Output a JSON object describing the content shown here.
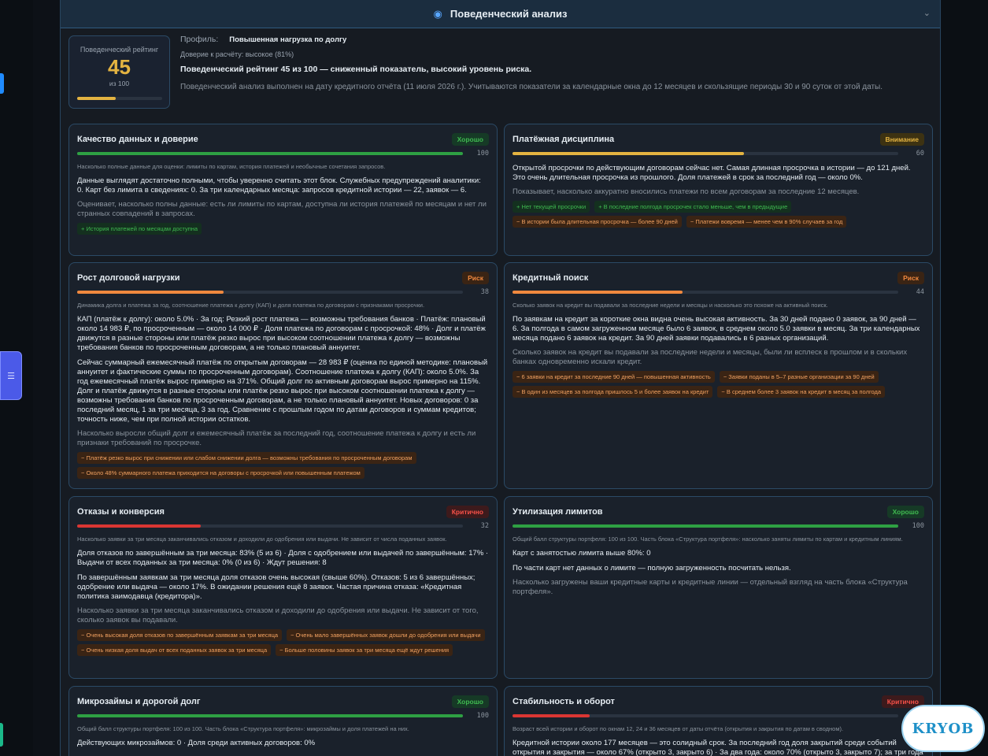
{
  "header": {
    "title": "Поведенческий анализ"
  },
  "summary": {
    "rating_label": "Поведенческий рейтинг",
    "score": "45",
    "of_label": "из 100",
    "score_fraction": 0.45,
    "profile_label": "Профиль:",
    "profile_value": "Повышенная нагрузка по долгу",
    "confidence": "Доверие к расчёту: высокое (81%)",
    "verdict": "Поведенческий рейтинг 45 из 100 — сниженный показатель, высокий уровень риска.",
    "description": "Поведенческий анализ выполнен на дату кредитного отчёта (11 июля 2026 г.). Учитываются показатели за календарные окна до 12 месяцев и скользящие периоды 30 и 90 суток от этой даты."
  },
  "cards": [
    {
      "title": "Качество данных и доверие",
      "badge": "Хорошо",
      "level": "good",
      "score": "100",
      "fraction": 1.0,
      "hint": "Насколько полные данные для оценки: лимиты по картам, история платежей и необычные сочетания запросов.",
      "body": [
        "Данные выглядят достаточно полными, чтобы уверенно считать этот блок. Служебных предупреждений аналитики: 0. Карт без лимита в сведениях: 0. За три календарных месяца: запросов кредитной истории — 22, заявок — 6."
      ],
      "muted": "Оценивает, насколько полны данные: есть ли лимиты по картам, доступна ли история платежей по месяцам и нет ли странных совпадений в запросах.",
      "tags": [
        {
          "text": "+ История платежей по месяцам доступна",
          "type": "pos"
        }
      ]
    },
    {
      "title": "Платёжная дисциплина",
      "badge": "Внимание",
      "level": "warn",
      "score": "60",
      "fraction": 0.6,
      "hint": "",
      "body": [
        "Открытой просрочки по действующим договорам сейчас нет. Самая длинная просрочка в истории — до 121 дней. Это очень длительная просрочка из прошлого. Доля платежей в срок за последний год — около 0%."
      ],
      "muted": "Показывает, насколько аккуратно вносились платежи по всем договорам за последние 12 месяцев.",
      "tags": [
        {
          "text": "+ Нет текущей просрочки",
          "type": "pos"
        },
        {
          "text": "+ В последние полгода просрочек стало меньше, чем в предыдущие",
          "type": "pos"
        },
        {
          "text": "− В истории была длительная просрочка — более 90 дней",
          "type": "neg"
        },
        {
          "text": "− Платежи вовремя — менее чем в 90% случаев за год",
          "type": "neg"
        }
      ]
    },
    {
      "title": "Рост долговой нагрузки",
      "badge": "Риск",
      "level": "risk",
      "score": "38",
      "fraction": 0.38,
      "hint": "Динамика долга и платежа за год, соотношение платежа к долгу (КАП) и доля платежа по договорам с признаками просрочки.",
      "body": [
        "КАП (платёж к долгу): около 5.0% · За год: Резкий рост платежа — возможны требования банков · Платёж: плановый около 14 983 ₽, по просроченным — около 14 000 ₽ · Доля платежа по договорам с просрочкой: 48% · Долг и платёж движутся в разные стороны или платёж резко вырос при высоком соотношении платежа к долгу — возможны требования банков по просроченным договорам, а не только плановый аннуитет.",
        "Сейчас суммарный ежемесячный платёж по открытым договорам — 28 983 ₽ (оценка по единой методике: плановый аннуитет и фактические суммы по просроченным договорам). Соотношение платежа к долгу (КАП): около 5.0%. За год ежемесячный платёж вырос примерно на 371%. Общий долг по активным договорам вырос примерно на 115%. Долг и платёж движутся в разные стороны или платёж резко вырос при высоком соотношении платежа к долгу — возможны требования банков по просроченным договорам, а не только плановый аннуитет. Новых договоров: 0 за последний месяц, 1 за три месяца, 3 за год. Сравнение с прошлым годом по датам договоров и суммам кредитов; точность ниже, чем при полной истории остатков."
      ],
      "muted": "Насколько выросли общий долг и ежемесячный платёж за последний год, соотношение платежа к долгу и есть ли признаки требований по просрочке.",
      "tags": [
        {
          "text": "− Платёж резко вырос при снижении или слабом снижении долга — возможны требования по просроченным договорам",
          "type": "neg"
        },
        {
          "text": "− Около 48% суммарного платежа приходится на договоры с просрочкой или повышенным платежом",
          "type": "neg"
        }
      ]
    },
    {
      "title": "Кредитный поиск",
      "badge": "Риск",
      "level": "risk",
      "score": "44",
      "fraction": 0.44,
      "hint": "Сколько заявок на кредит вы подавали за последние недели и месяцы и насколько это похоже на активный поиск.",
      "body": [
        "По заявкам на кредит за короткие окна видна очень высокая активность. За 30 дней подано 0 заявок, за 90 дней — 6. За полгода в самом загруженном месяце было 6 заявок, в среднем около 5.0 заявки в месяц. За три календарных месяца подано 6 заявок на кредит. За 90 дней заявки подавались в 6 разных организаций."
      ],
      "muted": "Сколько заявок на кредит вы подавали за последние недели и месяцы, были ли всплеск в прошлом и в скольких банках одновременно искали кредит.",
      "tags": [
        {
          "text": "− 6 заявки на кредит за последние 90 дней — повышенная активность",
          "type": "neg"
        },
        {
          "text": "− Заявки поданы в 5–7 разные организации за 90 дней",
          "type": "neg"
        },
        {
          "text": "− В один из месяцев за полгода пришлось 5 и более заявок на кредит",
          "type": "neg"
        },
        {
          "text": "− В среднем более 3 заявок на кредит в месяц за полгода",
          "type": "neg"
        }
      ]
    },
    {
      "title": "Отказы и конверсия",
      "badge": "Критично",
      "level": "crit",
      "score": "32",
      "fraction": 0.32,
      "hint": "Насколько заявки за три месяца заканчивались отказом и доходили до одобрения или выдачи. Не зависит от числа поданных заявок.",
      "body": [
        "Доля отказов по завершённым за три месяца: 83% (5 из 6) · Доля с одобрением или выдачей по завершённым: 17% · Выдачи от всех поданных за три месяца: 0% (0 из 6) · Ждут решения: 8",
        "По завершённым заявкам за три месяца доля отказов очень высокая (свыше 60%). Отказов: 5 из 6 завершённых; одобрение или выдача — около 17%. В ожидании решения ещё 8 заявок. Частая причина отказа: «Кредитная политика заимодавца (кредитора)»."
      ],
      "muted": "Насколько заявки за три месяца заканчивались отказом и доходили до одобрения или выдачи. Не зависит от того, сколько заявок вы подавали.",
      "tags": [
        {
          "text": "− Очень высокая доля отказов по завершённым заявкам за три месяца",
          "type": "neg"
        },
        {
          "text": "− Очень мало завершённых заявок дошли до одобрения или выдачи",
          "type": "neg"
        },
        {
          "text": "− Очень низкая доля выдач от всех поданных заявок за три месяца",
          "type": "neg"
        },
        {
          "text": "− Больше половины заявок за три месяца ещё ждут решения",
          "type": "neg"
        }
      ]
    },
    {
      "title": "Утилизация лимитов",
      "badge": "Хорошо",
      "level": "good",
      "score": "100",
      "fraction": 1.0,
      "hint": "Общий балл структуры портфеля: 100 из 100. Часть блока «Структура портфеля»: насколько заняты лимиты по картам и кредитным линиям.",
      "body": [
        "Карт с занятостью лимита выше 80%: 0",
        "По части карт нет данных о лимите — полную загруженность посчитать нельзя."
      ],
      "muted": "Насколько загружены ваши кредитные карты и кредитные линии — отдельный взгляд на часть блока «Структура портфеля».",
      "tags": []
    },
    {
      "title": "Микрозаймы и дорогой долг",
      "badge": "Хорошо",
      "level": "good",
      "score": "100",
      "fraction": 1.0,
      "hint": "Общий балл структуры портфеля: 100 из 100. Часть блока «Структура портфеля»: микрозаймы и доля платежей на них.",
      "body": [
        "Действующих микрозаймов: 0 · Доля среди активных договоров: 0%"
      ],
      "muted": "",
      "tags": []
    },
    {
      "title": "Стабильность и оборот",
      "badge": "Критично",
      "level": "crit",
      "score": "20",
      "fraction": 0.2,
      "hint": "Возраст всей истории и оборот по окнам 12, 24 и 36 месяцев от даты отчёта (открытия и закрытия по датам в сводном).",
      "body": [
        "Кредитной истории около 177 месяцев — это солидный срок. За последний год доля закрытий среди событий открытия и закрытия — около 67% (открыто 3, закрыто 6) · За два года: около 70% (открыто 3, закрыто 7); за три года"
      ],
      "muted": "",
      "tags": []
    }
  ],
  "logo_text": "KRYOB"
}
